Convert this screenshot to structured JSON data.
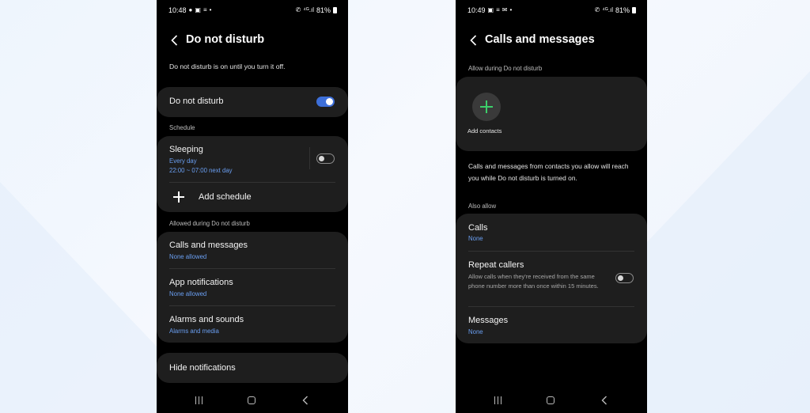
{
  "left_screen": {
    "status": {
      "time": "10:48",
      "battery": "81%"
    },
    "title": "Do not disturb",
    "info": "Do not disturb is on until you turn it off.",
    "dnd_toggle": {
      "label": "Do not disturb",
      "on": true
    },
    "schedule": {
      "section_label": "Schedule",
      "sleeping": {
        "title": "Sleeping",
        "days": "Every day",
        "time": "22:00 ~ 07:00 next day",
        "on": false
      },
      "add_label": "Add schedule"
    },
    "allowed": {
      "section_label": "Allowed during Do not disturb",
      "items": [
        {
          "title": "Calls and messages",
          "sub": "None allowed"
        },
        {
          "title": "App notifications",
          "sub": "None allowed"
        },
        {
          "title": "Alarms and sounds",
          "sub": "Alarms and media"
        }
      ]
    },
    "hide_notifications": "Hide notifications"
  },
  "right_screen": {
    "status": {
      "time": "10:49",
      "battery": "81%"
    },
    "title": "Calls and messages",
    "allow_label": "Allow during Do not disturb",
    "add_contacts": "Add contacts",
    "info": "Calls and messages from contacts you allow will reach you while Do not disturb is turned on.",
    "also_allow_label": "Also allow",
    "calls": {
      "title": "Calls",
      "sub": "None"
    },
    "repeat_callers": {
      "title": "Repeat callers",
      "desc": "Allow calls when they're received from the same phone number more than once within 15 minutes.",
      "on": false
    },
    "messages": {
      "title": "Messages",
      "sub": "None"
    }
  },
  "colors": {
    "accent": "#3d6fd9",
    "link": "#6a9ff2",
    "card": "#1e1e1e",
    "add_plus": "#3ccf6a"
  },
  "icons": {
    "back": "chevron-left-icon",
    "add": "plus-icon",
    "nav": [
      "recents-icon",
      "home-icon",
      "back-icon"
    ]
  }
}
